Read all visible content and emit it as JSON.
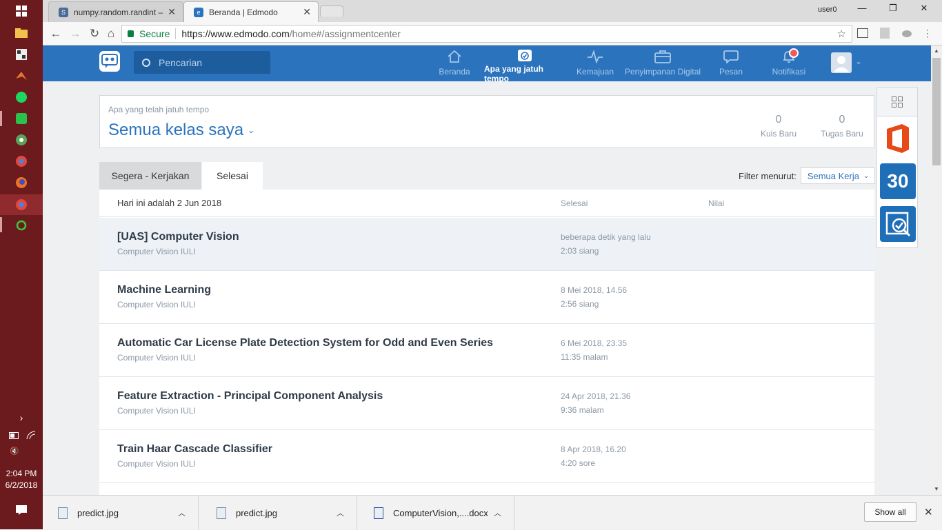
{
  "browser": {
    "tabs": [
      {
        "label": "numpy.random.randint –",
        "active": false
      },
      {
        "label": "Beranda | Edmodo",
        "active": true
      }
    ],
    "user": "user0",
    "secure_label": "Secure",
    "url_host": "https://www.edmodo.com",
    "url_path": "/home#/assignmentcenter"
  },
  "header": {
    "search_placeholder": "Pencarian",
    "nav": [
      {
        "label": "Beranda",
        "icon": "home-icon",
        "active": false
      },
      {
        "label": "Apa yang jatuh tempo",
        "icon": "clock-check-icon",
        "active": true
      },
      {
        "label": "Kemajuan",
        "icon": "pulse-icon",
        "active": false
      },
      {
        "label": "Penyimpanan Digital",
        "icon": "briefcase-icon",
        "active": false
      },
      {
        "label": "Pesan",
        "icon": "chat-icon",
        "active": false
      },
      {
        "label": "Notifikasi",
        "icon": "bell-icon",
        "active": false
      }
    ]
  },
  "summary": {
    "label": "Apa yang telah jatuh tempo",
    "classes": "Semua kelas saya",
    "stats": [
      {
        "num": "0",
        "label": "Kuis Baru"
      },
      {
        "num": "0",
        "label": "Tugas Baru"
      }
    ]
  },
  "tabs": [
    {
      "label": "Segera - Kerjakan",
      "active": false
    },
    {
      "label": "Selesai",
      "active": true
    }
  ],
  "filter": {
    "label": "Filter menurut:",
    "value": "Semua Kerja"
  },
  "list": {
    "today": "Hari ini adalah 2 Jun 2018",
    "col_done": "Selesai",
    "col_grade": "Nilai",
    "rows": [
      {
        "title": "[UAS] Computer Vision",
        "cls": "Computer Vision IULI",
        "d1": "beberapa detik yang lalu",
        "d2": "2:03 siang"
      },
      {
        "title": "Machine Learning",
        "cls": "Computer Vision IULI",
        "d1": "8 Mei 2018, 14.56",
        "d2": "2:56 siang"
      },
      {
        "title": "Automatic Car License Plate Detection System for Odd and Even Series",
        "cls": "Computer Vision IULI",
        "d1": "6 Mei 2018, 23.35",
        "d2": "11:35 malam"
      },
      {
        "title": "Feature Extraction - Principal Component Analysis",
        "cls": "Computer Vision IULI",
        "d1": "24 Apr 2018, 21.36",
        "d2": "9:36 malam"
      },
      {
        "title": "Train Haar Cascade Classifier",
        "cls": "Computer Vision IULI",
        "d1": "8 Apr 2018, 16.20",
        "d2": "4:20 sore"
      }
    ]
  },
  "rail": {
    "calendar_day": "30"
  },
  "taskbar": {
    "time": "2:04 PM",
    "date": "6/2/2018"
  },
  "downloads": {
    "items": [
      {
        "name": "predict.jpg"
      },
      {
        "name": "predict.jpg"
      },
      {
        "name": "ComputerVision,....docx"
      }
    ],
    "show_all": "Show all"
  },
  "colors": {
    "brand": "#2b73bd",
    "taskbar": "#6b1a1d"
  }
}
